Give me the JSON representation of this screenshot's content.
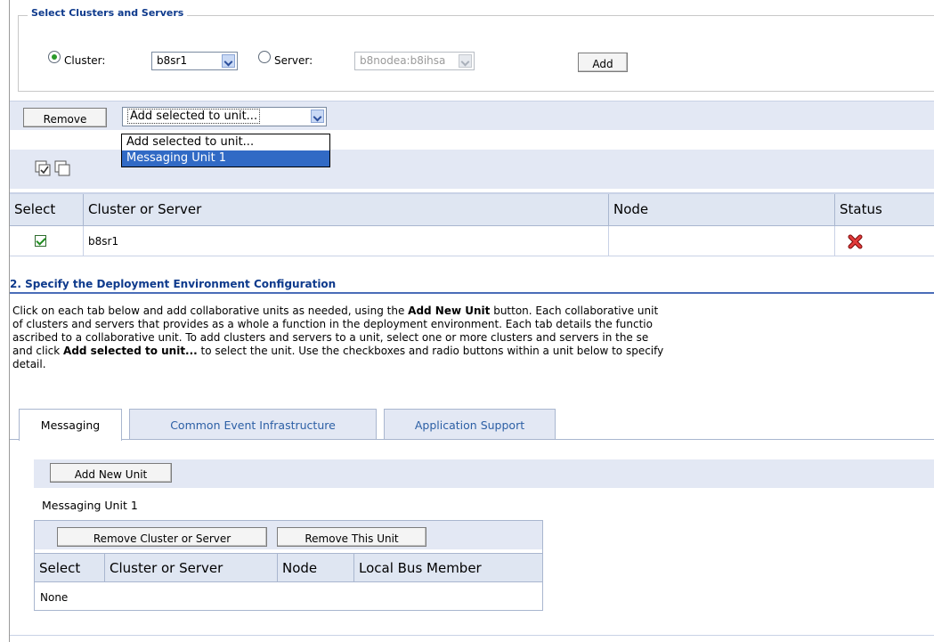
{
  "select_section": {
    "legend": "Select Clusters and Servers",
    "cluster_label": "Cluster:",
    "cluster_value": "b8sr1",
    "server_label": "Server:",
    "server_value": "b8nodea:b8ihsa",
    "add_label": "Add"
  },
  "toolbar": {
    "remove_label": "Remove",
    "actions_value": "Add selected to unit..."
  },
  "dropdown": {
    "options": [
      "Add selected to unit...",
      "Messaging Unit 1"
    ],
    "selected": "Messaging Unit 1"
  },
  "table": {
    "headers": [
      "Select",
      "Cluster or Server",
      "Node",
      "Status"
    ],
    "rows": [
      {
        "cluster": "b8sr1",
        "node": "",
        "status_icon": "error-x-icon",
        "checked": true
      }
    ]
  },
  "section2": {
    "title": "2. Specify the Deployment Environment Configuration",
    "lines": [
      [
        "Click on each tab below and add collaborative units as needed, using the ",
        "Add New Unit",
        " button. Each collaborative unit"
      ],
      [
        "of clusters and servers that provides as a whole a function in the deployment environment. Each tab details the functio",
        "",
        ""
      ],
      [
        "ascribed to a collaborative unit. To add clusters and servers to a unit, select one or more clusters and servers in the se",
        "",
        ""
      ],
      [
        "and click ",
        "Add selected to unit...",
        " to select the unit. Use the checkboxes and radio buttons within a unit below to specify"
      ],
      [
        "detail.",
        "",
        ""
      ]
    ]
  },
  "tabs": [
    "Messaging",
    "Common Event Infrastructure",
    "Application Support"
  ],
  "messaging": {
    "add_new_unit_label": "Add New Unit",
    "unit_name": "Messaging Unit 1",
    "remove_cluster_label": "Remove Cluster or Server",
    "remove_unit_label": "Remove This Unit",
    "headers": [
      "Select",
      "Cluster or Server",
      "Node",
      "Local Bus Member"
    ],
    "empty_text": "None"
  },
  "colors": {
    "accent": "#0e3a8c",
    "bar": "#e3e8f4",
    "selection": "#316ac5",
    "error": "#cc1f1f"
  }
}
